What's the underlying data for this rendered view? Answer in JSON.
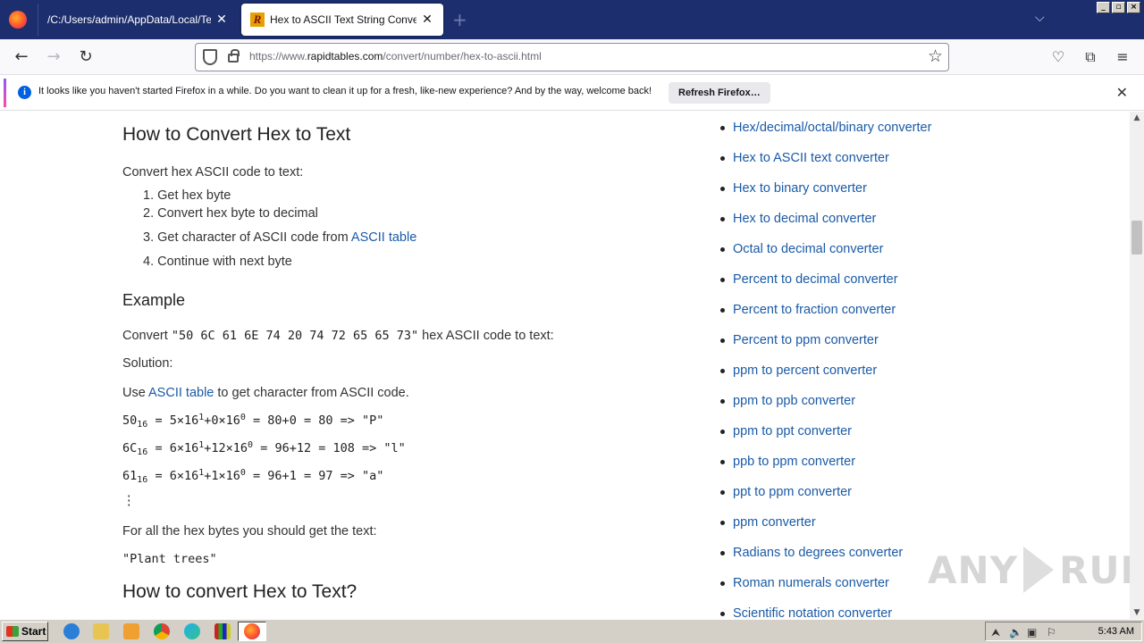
{
  "tabs": [
    {
      "label": "/C:/Users/admin/AppData/Local/Temp/i",
      "active": false
    },
    {
      "label": "Hex to ASCII Text String Converte",
      "active": true
    }
  ],
  "window_controls": {
    "minimize": "_",
    "restore": "▫",
    "close": "×"
  },
  "address": {
    "prefix": "https://www.",
    "host": "rapidtables.com",
    "path": "/convert/number/hex-to-ascii.html"
  },
  "notification": {
    "text": "It looks like you haven't started Firefox in a while. Do you want to clean it up for a fresh, like-new experience? And by the way, welcome back!",
    "button": "Refresh Firefox…"
  },
  "article": {
    "heading1": "How to Convert Hex to Text",
    "intro": "Convert hex ASCII code to text:",
    "steps": [
      {
        "num": "1.",
        "text": "Get hex byte"
      },
      {
        "num": "2.",
        "text": "Convert hex byte to decimal"
      },
      {
        "num": "3.",
        "text": "Get character of ASCII code from ",
        "link": "ASCII table"
      },
      {
        "num": "4.",
        "text": "Continue with next byte"
      }
    ],
    "example_heading": "Example",
    "convert_prefix": "Convert ",
    "convert_code": "\"50 6C 61 6E 74 20 74 72 65 65 73\"",
    "convert_suffix": " hex ASCII code to text:",
    "solution": "Solution:",
    "use_prefix": "Use ",
    "use_link": "ASCII table",
    "use_suffix": " to get character from ASCII code.",
    "lines": [
      {
        "hex": "50",
        "base": "16",
        "eq1": " = 5×16",
        "exp1": "1",
        "eq2": "+0×16",
        "exp0": "0",
        "rest": " = 80+0 = 80 => \"P\""
      },
      {
        "hex": "6C",
        "base": "16",
        "eq1": " = 6×16",
        "exp1": "1",
        "eq2": "+12×16",
        "exp0": "0",
        "rest": " = 96+12 = 108 => \"l\""
      },
      {
        "hex": "61",
        "base": "16",
        "eq1": " = 6×16",
        "exp1": "1",
        "eq2": "+1×16",
        "exp0": "0",
        "rest": " = 96+1 = 97 => \"a\""
      }
    ],
    "ellipsis": "⋮",
    "all_bytes": "For all the hex bytes you should get the text:",
    "result": "\"Plant trees\"",
    "heading2": "How to convert Hex to Text?"
  },
  "sidebar_links": [
    "Hex/decimal/octal/binary converter",
    "Hex to ASCII text converter",
    "Hex to binary converter",
    "Hex to decimal converter",
    "Octal to decimal converter",
    "Percent to decimal converter",
    "Percent to fraction converter",
    "Percent to ppm converter",
    "ppm to percent converter",
    "ppm to ppb converter",
    "ppm to ppt converter",
    "ppb to ppm converter",
    "ppt to ppm converter",
    "ppm converter",
    "Radians to degrees converter",
    "Roman numerals converter",
    "Scientific notation converter"
  ],
  "watermark": {
    "left": "ANY",
    "right": "RUN"
  },
  "taskbar": {
    "start": "Start",
    "clock": "5:43 AM"
  },
  "colors": {
    "tabbar": "#1c2e6e",
    "link": "#1a5aa6",
    "taskbar": "#d4d0c8"
  }
}
